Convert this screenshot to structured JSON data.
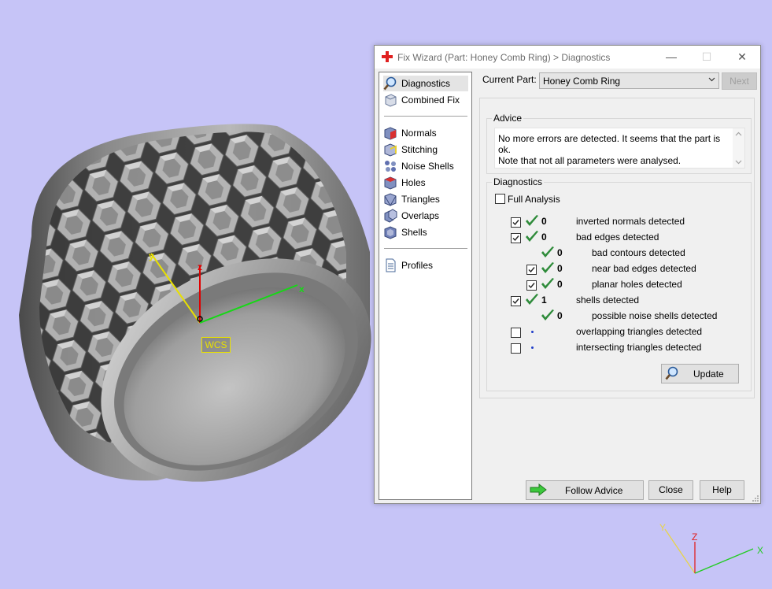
{
  "viewport": {
    "wcs_label": "WCS",
    "axes": {
      "x": "x",
      "y": "y",
      "z": "z"
    },
    "mini_axes": {
      "x": "X",
      "y": "Y",
      "z": "Z"
    },
    "background_color": "#c6c4f7",
    "model_color": "#9a9a9a"
  },
  "dialog": {
    "title": "Fix Wizard (Part: Honey Comb Ring) > Diagnostics",
    "window_buttons": {
      "minimize": "—",
      "maximize": "☐",
      "close": "✕"
    },
    "nav": {
      "group1": [
        {
          "label": "Diagnostics",
          "icon": "magnifier-icon",
          "selected": true
        },
        {
          "label": "Combined Fix",
          "icon": "cube-icon"
        }
      ],
      "group2": [
        {
          "label": "Normals",
          "icon": "normals-cube-icon"
        },
        {
          "label": "Stitching",
          "icon": "stitching-cube-icon"
        },
        {
          "label": "Noise Shells",
          "icon": "noise-shells-icon"
        },
        {
          "label": "Holes",
          "icon": "holes-cube-icon"
        },
        {
          "label": "Triangles",
          "icon": "triangles-icon"
        },
        {
          "label": "Overlaps",
          "icon": "overlaps-icon"
        },
        {
          "label": "Shells",
          "icon": "shells-icon"
        }
      ],
      "group3": [
        {
          "label": "Profiles",
          "icon": "document-icon"
        }
      ]
    },
    "current_part_label": "Current Part:",
    "current_part_value": "Honey Comb Ring",
    "next_label": "Next",
    "advice": {
      "title": "Advice",
      "line1": "No more errors are detected. It seems that the part is ok.",
      "line2": "Note that not all parameters were analysed."
    },
    "diagnostics": {
      "title": "Diagnostics",
      "full_analysis_label": "Full Analysis",
      "full_analysis_checked": false,
      "rows": [
        {
          "checked": true,
          "status": "ok",
          "count": "0",
          "label": "inverted normals detected",
          "indent": 0,
          "has_checkbox": true
        },
        {
          "checked": true,
          "status": "ok",
          "count": "0",
          "label": "bad edges detected",
          "indent": 0,
          "has_checkbox": true
        },
        {
          "checked": false,
          "status": "ok",
          "count": "0",
          "label": "bad contours detected",
          "indent": 1,
          "has_checkbox": false
        },
        {
          "checked": true,
          "status": "ok",
          "count": "0",
          "label": "near bad edges detected",
          "indent": 1,
          "has_checkbox": true
        },
        {
          "checked": true,
          "status": "ok",
          "count": "0",
          "label": "planar holes detected",
          "indent": 1,
          "has_checkbox": true
        },
        {
          "checked": true,
          "status": "ok",
          "count": "1",
          "label": "shells detected",
          "indent": 0,
          "has_checkbox": true
        },
        {
          "checked": false,
          "status": "ok",
          "count": "0",
          "label": "possible noise shells detected",
          "indent": 1,
          "has_checkbox": false
        },
        {
          "checked": false,
          "status": "none",
          "count": "",
          "label": "overlapping triangles detected",
          "indent": 0,
          "has_checkbox": true
        },
        {
          "checked": false,
          "status": "none",
          "count": "",
          "label": "intersecting triangles detected",
          "indent": 0,
          "has_checkbox": true
        }
      ],
      "update_label": "Update"
    },
    "follow_advice_label": "Follow Advice",
    "close_label": "Close",
    "help_label": "Help",
    "accent_green": "#2e8b3a"
  }
}
